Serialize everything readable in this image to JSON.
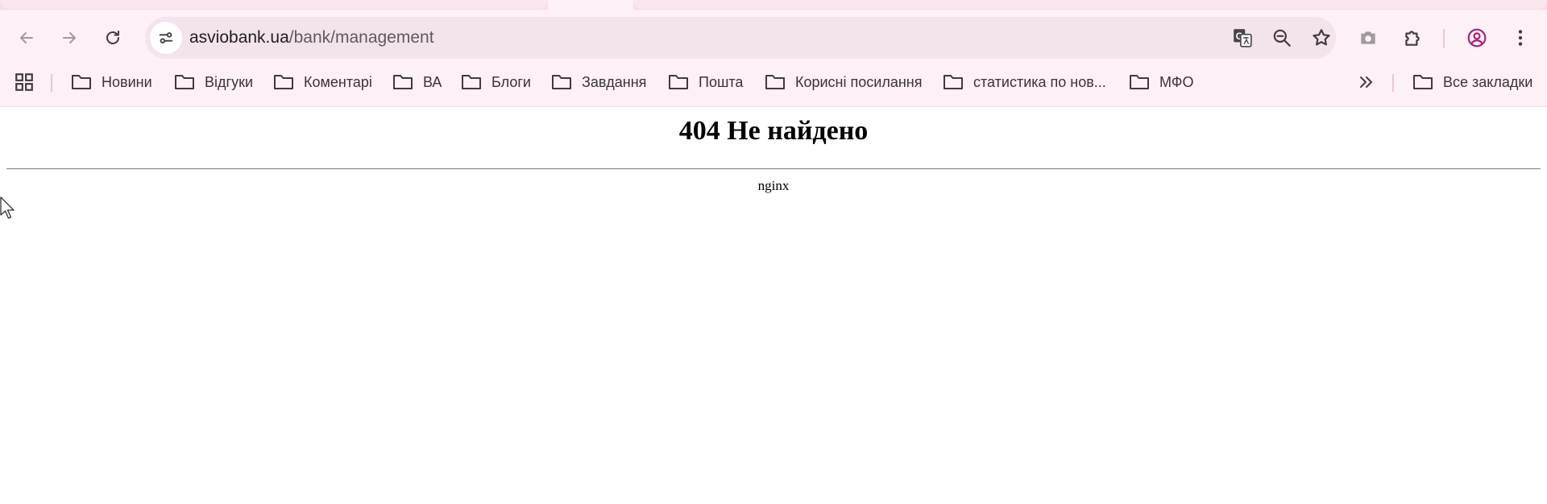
{
  "browser": {
    "url_host": "asviobank.ua",
    "url_path": "/bank/management",
    "accent_color": "#a21f7e"
  },
  "toolbar": {
    "icons": [
      "back-icon",
      "forward-icon",
      "reload-icon",
      "site-info-icon",
      "translate-icon",
      "zoom-out-icon",
      "bookmark-star-icon",
      "screenshot-icon",
      "extensions-icon",
      "profile-icon",
      "menu-icon"
    ]
  },
  "bookmarks": {
    "items": [
      {
        "label": "Новини"
      },
      {
        "label": "Відгуки"
      },
      {
        "label": "Коментарі"
      },
      {
        "label": "ВА"
      },
      {
        "label": "Блоги"
      },
      {
        "label": "Завдання"
      },
      {
        "label": "Пошта"
      },
      {
        "label": "Корисні посилання"
      },
      {
        "label": "статистика по нов..."
      },
      {
        "label": "МФО"
      }
    ],
    "all_bookmarks": "Все закладки"
  },
  "page": {
    "title": "404 Не найдено",
    "server": "nginx"
  }
}
